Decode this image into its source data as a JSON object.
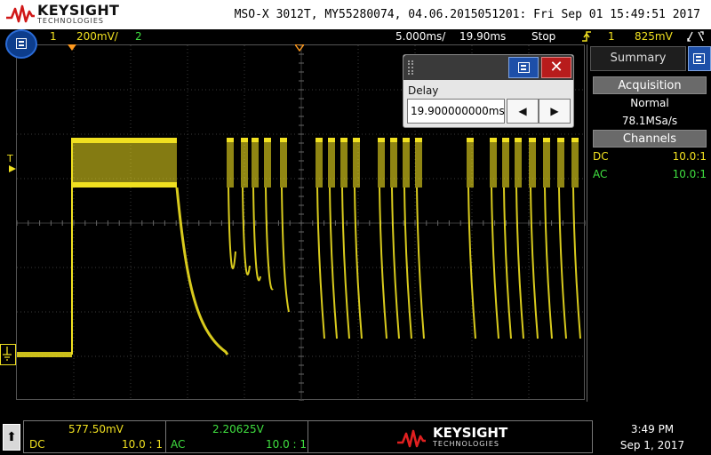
{
  "brand": {
    "name": "KEYSIGHT",
    "sub": "TECHNOLOGIES"
  },
  "title": "MSO-X 3012T, MY55280074, 04.06.2015051201: Fri Sep 01 15:49:51 2017",
  "status": {
    "ch1_num": "1",
    "ch1_scale": "200mV/",
    "ch2_num": "2",
    "timebase": "5.000ms/",
    "delay": "19.90ms",
    "run_state": "Stop",
    "trig_icon": "trigger-edge-icon",
    "trig_source": "1",
    "trig_level": "825mV"
  },
  "colors": {
    "ch1": "#f0e020",
    "ch2": "#40e040",
    "accent": "#1d4fa8",
    "close": "#b81c1c"
  },
  "delay_dialog": {
    "label": "Delay",
    "value": "19.900000000ms",
    "close_glyph": "✕",
    "left_glyph": "◀",
    "right_glyph": "▶"
  },
  "markers": {
    "trigger_level": "T"
  },
  "summary": {
    "tab_label": "Summary",
    "acquisition_head": "Acquisition",
    "acq_mode": "Normal",
    "sample_rate": "78.1MSa/s",
    "channels_head": "Channels",
    "channels": [
      {
        "coupling": "DC",
        "probe": "10.0:1"
      },
      {
        "coupling": "AC",
        "probe": "10.0:1"
      }
    ]
  },
  "bottom": {
    "home_glyph": "⬆",
    "ch1_offset": "577.50mV",
    "ch1_coupling": "DC",
    "ch1_probe": "10.0 : 1",
    "ch2_offset": "2.20625V",
    "ch2_coupling": "AC",
    "ch2_probe": "10.0 : 1",
    "brand": "KEYSIGHT",
    "brand_sub": "TECHNOLOGIES",
    "time": "3:49 PM",
    "date": "Sep 1, 2017"
  }
}
